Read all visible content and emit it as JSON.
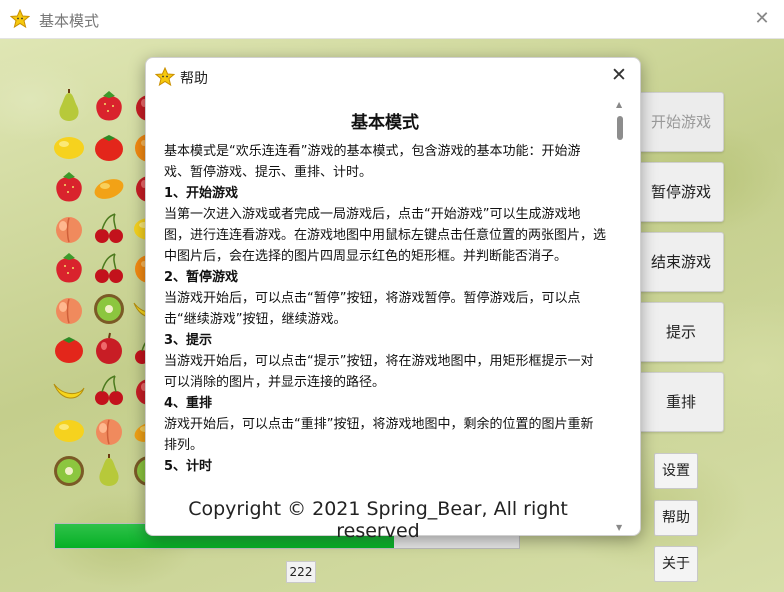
{
  "window": {
    "title": "基本模式"
  },
  "board": {
    "tiles": [
      [
        "pear",
        "strawberry",
        "apple"
      ],
      [
        "lemon",
        "tomato",
        "orange"
      ],
      [
        "strawberry",
        "mango",
        "apple"
      ],
      [
        "peach",
        "cherry",
        "lemon"
      ],
      [
        "strawberry",
        "cherry",
        "orange"
      ],
      [
        "peach",
        "kiwi",
        "banana"
      ],
      [
        "tomato",
        "apple",
        "cherry"
      ],
      [
        "banana",
        "cherry",
        "apple"
      ],
      [
        "lemon",
        "peach",
        "mango"
      ],
      [
        "kiwi",
        "pear",
        "kiwi"
      ]
    ]
  },
  "sidebar": {
    "start": "开始游戏",
    "pause": "暂停游戏",
    "end": "结束游戏",
    "hint": "提示",
    "reshuffle": "重排",
    "settings": "设置",
    "help": "帮助",
    "about": "关于"
  },
  "progress": {
    "value": 0.73,
    "time": "222"
  },
  "dialog": {
    "title": "帮助",
    "heading": "基本模式",
    "intro": "基本模式是“欢乐连连看”游戏的基本模式，包含游戏的基本功能：开始游戏、暂停游戏、提示、重排、计时。",
    "sections": [
      {
        "title": "1、开始游戏",
        "body": "当第一次进入游戏或者完成一局游戏后，点击“开始游戏”可以生成游戏地图，进行连连看游戏。在游戏地图中用鼠标左键点击任意位置的两张图片，选中图片后，会在选择的图片四周显示红色的矩形框。并判断能否消子。"
      },
      {
        "title": "2、暂停游戏",
        "body": "当游戏开始后，可以点击“暂停”按钮，将游戏暂停。暂停游戏后，可以点击“继续游戏”按钮，继续游戏。"
      },
      {
        "title": "3、提示",
        "body": "当游戏开始后，可以点击“提示”按钮，将在游戏地图中，用矩形框提示一对可以消除的图片，并显示连接的路径。"
      },
      {
        "title": "4、重排",
        "body": "游戏开始后，可以点击“重排”按钮，将游戏地图中，剩余的位置的图片重新排列。"
      },
      {
        "title": "5、计时",
        "body": ""
      }
    ],
    "footer": "Copyright © 2021 Spring_Bear, All right reserved"
  },
  "colors": {
    "progress": "#06b025",
    "accent_star": "#f6c90e"
  }
}
